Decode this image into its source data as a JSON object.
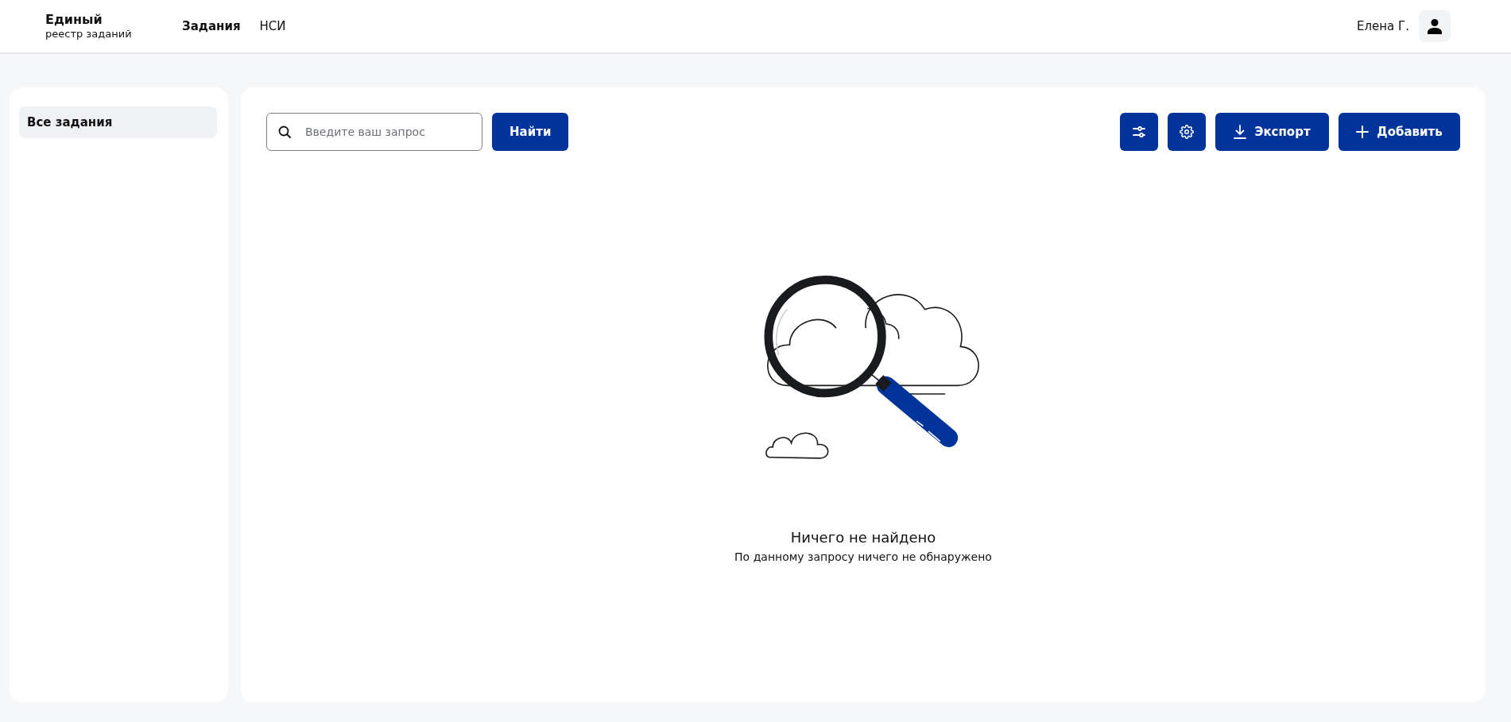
{
  "header": {
    "logo": {
      "title": "Единый",
      "subtitle": "реестр заданий"
    },
    "nav": [
      {
        "label": "Задания",
        "selected": true
      },
      {
        "label": "НСИ",
        "selected": false
      }
    ],
    "user": {
      "name": "Елена Г."
    }
  },
  "sidebar": {
    "items": [
      {
        "label": "Все задания",
        "selected": true
      }
    ]
  },
  "toolbar": {
    "search": {
      "placeholder": "Введите ваш запрос"
    },
    "search_button": "Найти",
    "actions": [
      {
        "kind": "filters"
      },
      {
        "kind": "settings"
      },
      {
        "kind": "export",
        "label": "Экспорт"
      },
      {
        "kind": "add",
        "label": "Добавить"
      }
    ]
  },
  "empty_state": {
    "title": "Ничего не найдено",
    "message": "По данному запросу ничего не обнаружено"
  }
}
